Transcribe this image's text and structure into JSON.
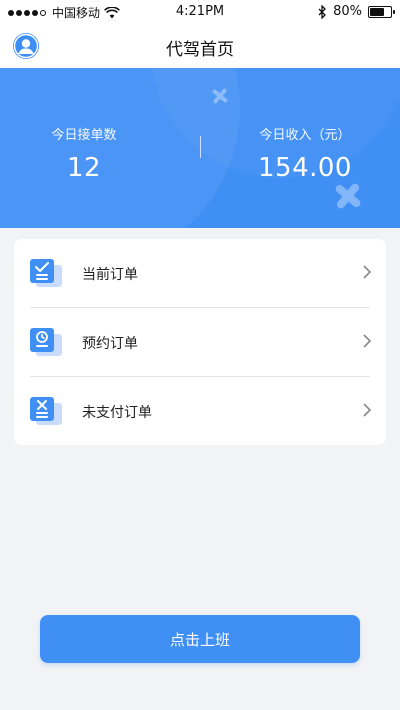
{
  "status_bar": {
    "carrier": "中国移动",
    "time": "4:21PM",
    "battery_percent": "80%",
    "battery_level": 0.8,
    "signal_bars_filled": 4,
    "signal_bars_total": 5
  },
  "nav": {
    "title": "代驾首页",
    "avatar_icon": "user-icon"
  },
  "stats": {
    "orders_label": "今日接单数",
    "orders_value": "12",
    "income_label": "今日收入（元）",
    "income_value": "154.00"
  },
  "menu": {
    "items": [
      {
        "label": "当前订单",
        "icon": "check-list-icon"
      },
      {
        "label": "预约订单",
        "icon": "clock-list-icon"
      },
      {
        "label": "未支付订单",
        "icon": "x-list-icon"
      }
    ]
  },
  "action": {
    "start_shift_label": "点击上班"
  },
  "colors": {
    "primary_blue": "#3f8ff5",
    "background": "#f2f3f5"
  }
}
